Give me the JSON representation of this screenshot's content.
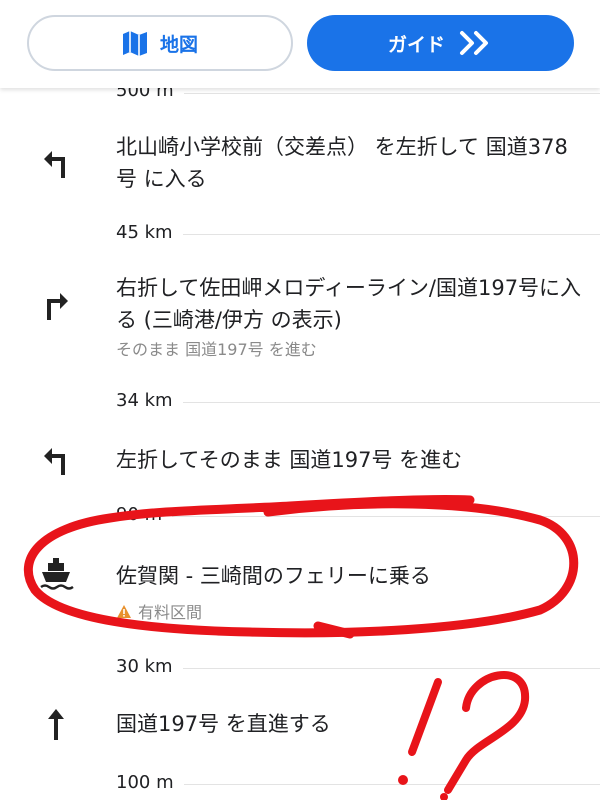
{
  "header": {
    "map_label": "地図",
    "guide_label": "ガイド",
    "accent": "#1a73e8"
  },
  "steps": [
    {
      "distance": "500 m"
    },
    {
      "icon": "turn-left-icon",
      "text": "北山崎小学校前（交差点） を左折して 国道378号 に入る",
      "distance": "45 km"
    },
    {
      "icon": "turn-right-icon",
      "text": "右折して佐田岬メロディーライン/国道197号に入る (三崎港/伊方 の表示)",
      "sub": "そのまま 国道197号 を進む",
      "distance": "34 km"
    },
    {
      "icon": "turn-left-icon",
      "text": "左折してそのまま 国道197号 を進む",
      "distance": "90 m"
    },
    {
      "icon": "ferry-icon",
      "text": "佐賀関 - 三崎間のフェリーに乗る",
      "sub": "有料区間",
      "sub_icon": "warning-icon",
      "distance": "30 km"
    },
    {
      "icon": "straight-icon",
      "text": "国道197号 を直進する",
      "distance": "100 m"
    }
  ],
  "annotation": {
    "text": "!?",
    "color": "#e8141a"
  }
}
